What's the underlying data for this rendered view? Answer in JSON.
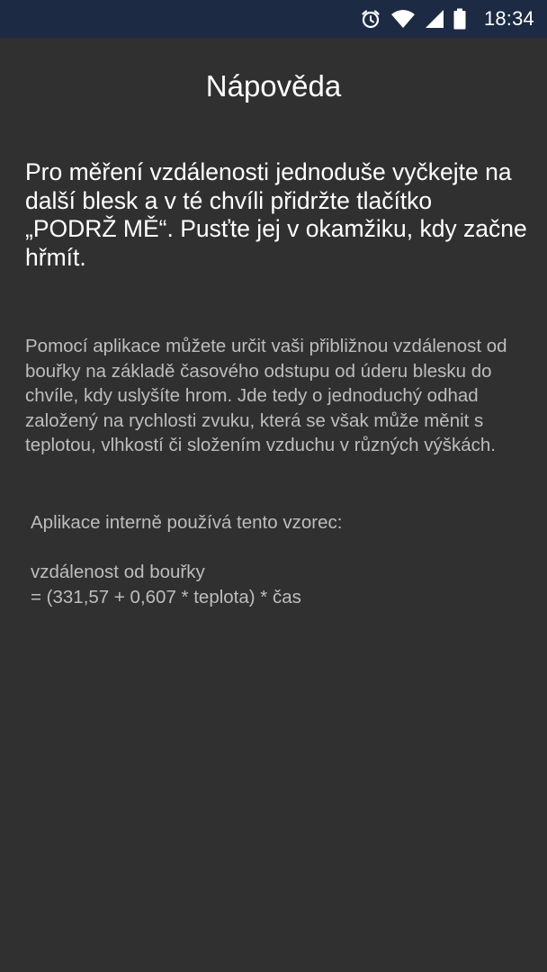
{
  "status_bar": {
    "time": "18:34",
    "icons": [
      "alarm-icon",
      "wifi-icon",
      "signal-icon",
      "battery-icon"
    ],
    "background": "#1c2a44"
  },
  "help": {
    "title": "Nápověda",
    "instructions": "Pro měření vzdálenosti jednoduše vyčkejte na další blesk a v té chvíli přidržte tlačítko „PODRŽ MĚ“. Pusťte jej v okamžiku, kdy začne hřmít.",
    "description": "Pomocí aplikace můžete určit vaši přibližnou vzdálenost od bouřky na základě časového odstupu od úderu blesku do chvíle, kdy uslyšíte hrom. Jde tedy o jednoduchý odhad založený na rychlosti zvuku, která se však může měnit s teplotou, vlhkostí či složením vzduchu v různých výškách.",
    "formula_intro": "Aplikace interně používá tento vzorec:",
    "formula_line1": "vzdálenost od bouřky",
    "formula_line2": "= (331,57 + 0,607 * teplota) * čas"
  },
  "colors": {
    "background": "#303030",
    "primary_text": "#ffffff",
    "secondary_text": "#bdbdbd"
  }
}
